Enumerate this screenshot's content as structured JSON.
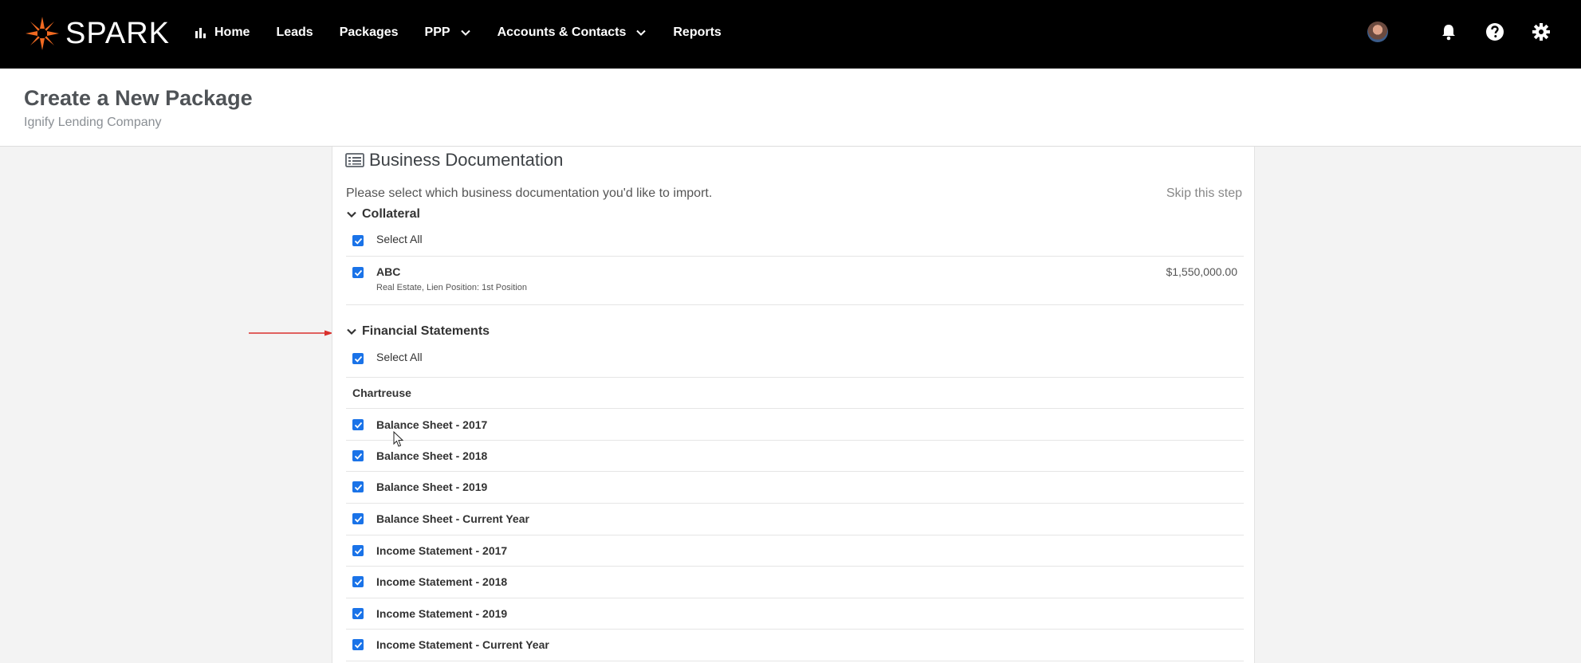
{
  "brand": {
    "name": "SPARK",
    "accent": "#f26a21"
  },
  "nav": {
    "items": [
      {
        "label": "Home",
        "icon": "bar-chart-icon"
      },
      {
        "label": "Leads"
      },
      {
        "label": "Packages"
      },
      {
        "label": "PPP",
        "icon": "chevron-down-icon"
      },
      {
        "label": "Accounts & Contacts",
        "icon": "chevron-down-icon"
      },
      {
        "label": "Reports"
      }
    ],
    "right_icons": [
      "avatar",
      "bell-icon",
      "help-icon",
      "gear-icon"
    ]
  },
  "page": {
    "title": "Create a New Package",
    "subtitle": "Ignify Lending Company"
  },
  "card": {
    "title": "Business Documentation",
    "title_icon": "list-card-icon",
    "intro": "Please select which business documentation you'd like to import.",
    "skip": "Skip this step",
    "checkbox_color": "#1a73e8"
  },
  "collateral": {
    "heading": "Collateral",
    "select_all": "Select All",
    "items": [
      {
        "name": "ABC",
        "detail": "Real Estate, Lien Position: 1st Position",
        "amount": "$1,550,000.00",
        "checked": true
      }
    ]
  },
  "financial": {
    "heading": "Financial Statements",
    "select_all": "Select All",
    "group": "Chartreuse",
    "items": [
      {
        "label": "Balance Sheet - 2017",
        "checked": true
      },
      {
        "label": "Balance Sheet - 2018",
        "checked": true
      },
      {
        "label": "Balance Sheet - 2019",
        "checked": true
      },
      {
        "label": "Balance Sheet - Current Year",
        "checked": true
      },
      {
        "label": "Income Statement - 2017",
        "checked": true
      },
      {
        "label": "Income Statement - 2018",
        "checked": true
      },
      {
        "label": "Income Statement - 2019",
        "checked": true
      },
      {
        "label": "Income Statement - Current Year",
        "checked": true
      }
    ]
  }
}
